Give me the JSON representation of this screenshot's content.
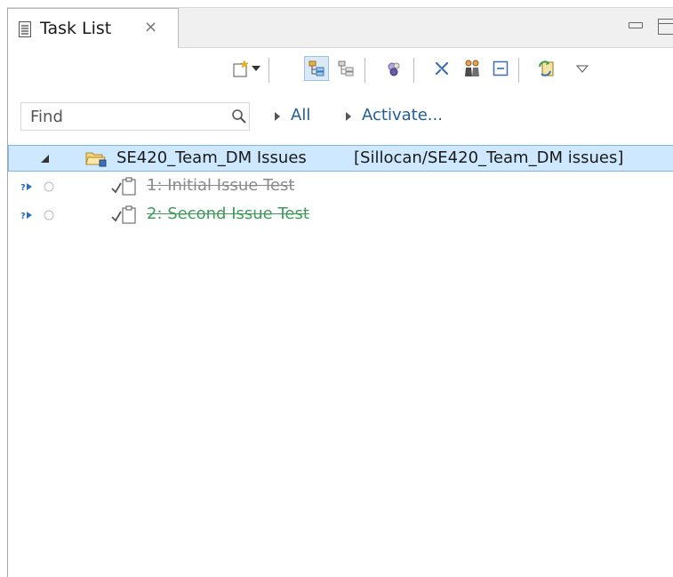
{
  "view": {
    "tab_title": "Task List",
    "tab_close_glyph": "⨯",
    "tab_icon": "task-list-icon"
  },
  "toolbar": {
    "buttons": [
      "new-task-icon",
      "dropdown-arrow-icon",
      "categorized-icon",
      "scheduled-icon",
      "focus-on-workweek-icon",
      "hide-completed-icon",
      "show-only-my-tasks-icon",
      "collapse-all-icon",
      "synchronize-icon",
      "view-menu-icon"
    ]
  },
  "filter": {
    "find_placeholder": "Find",
    "all_label": "All",
    "activate_label": "Activate..."
  },
  "tree": {
    "query": {
      "name": "SE420_Team_DM Issues",
      "repository": "[Sillocan/SE420_Team_DM issues]"
    },
    "tasks": [
      {
        "label": "1: Initial Issue Test",
        "status": "completed",
        "color": "#8a8a8a"
      },
      {
        "label": "2: Second Issue Test",
        "status": "completed",
        "color": "#3f9b5a"
      }
    ]
  },
  "colors": {
    "selection_bg": "#cde8ff",
    "link": "#1d5c9d",
    "incoming_icon": "#2c6bbd"
  }
}
